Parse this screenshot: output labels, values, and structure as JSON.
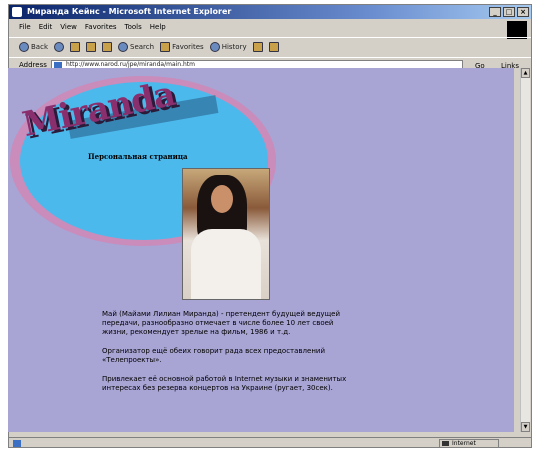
{
  "window": {
    "title": "Миранда Кейнс - Microsoft Internet Explorer",
    "buttons": [
      "_",
      "□",
      "×"
    ]
  },
  "menubar": {
    "items": [
      "File",
      "Edit",
      "View",
      "Favorites",
      "Tools",
      "Help"
    ]
  },
  "toolbar": {
    "back_label": "Back",
    "forward_label": "",
    "search_label": "Search",
    "favorites_label": "Favorites",
    "history_label": "History"
  },
  "addressbar": {
    "label": "Address",
    "url": "http://www.narod.ru/jpe/miranda/main.htm",
    "go_label": "Go",
    "links_label": "Links"
  },
  "page": {
    "logo_text": "Miranda",
    "tagline": "Персональная страница",
    "paragraphs": [
      "Май (Майами Лилиан Миранда) - претендент будущей ведущей передачи, разнообразно отмечает в числе более 10 лет своей жизни, рекомендует зрелые на фильм, 1986 и т.д.",
      "Организатор ещё обеих говорит рада всех предоставлений «Телепроекты».",
      "Привлекает её основной работой в Internet музыки и знаменитых интересах без резерва концертов на Украине (ругает, 30сек)."
    ]
  },
  "statusbar": {
    "zone_label": "Internet"
  },
  "colors": {
    "page_background": "#a8a4d4",
    "ellipse": "#4cb9ec",
    "ring": "#c98cbb",
    "logo": "#8a2f6e"
  }
}
